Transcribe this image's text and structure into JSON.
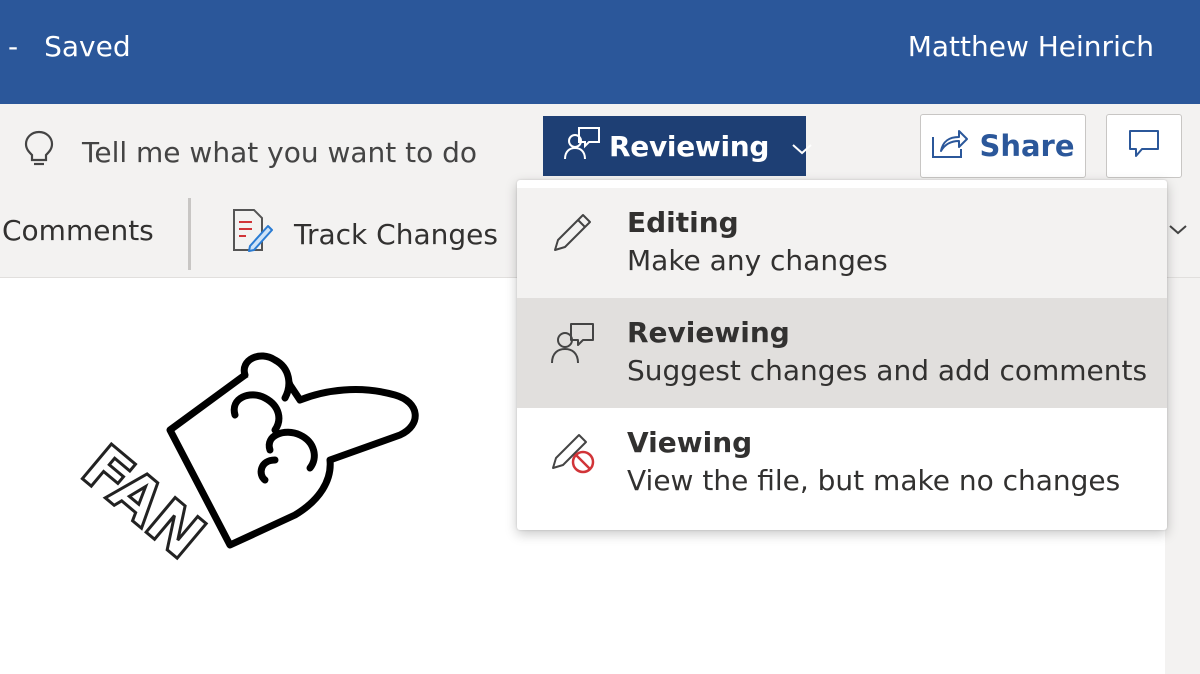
{
  "titlebar": {
    "separator": "-",
    "status": "Saved",
    "user_name": "Matthew Heinrich",
    "bg_color": "#2b579a"
  },
  "commandbar": {
    "tellme_placeholder": "Tell me what you want to do",
    "tellme_icon": "lightbulb-icon",
    "mode_button": {
      "label": "Reviewing",
      "icon": "reviewer-person-icon"
    },
    "share_label": "Share",
    "comments_icon": "comment-bubble-icon"
  },
  "ribbon": {
    "comments_label": "Comments",
    "track_changes_label": "Track Changes"
  },
  "mode_menu": {
    "items": [
      {
        "title": "Editing",
        "description": "Make any changes",
        "icon": "pencil-icon",
        "state": "hover"
      },
      {
        "title": "Reviewing",
        "description": "Suggest changes and add comments",
        "icon": "reviewer-person-icon",
        "state": "selected"
      },
      {
        "title": "Viewing",
        "description": "View the file, but make no changes",
        "icon": "pencil-prohibited-icon",
        "state": "normal"
      }
    ]
  },
  "document": {
    "sticker_text": "FAN"
  },
  "colors": {
    "accent": "#2b579a",
    "mode_button": "#1e3f74",
    "selected_item": "#e1dfdd",
    "prohibit_red": "#d13438"
  }
}
